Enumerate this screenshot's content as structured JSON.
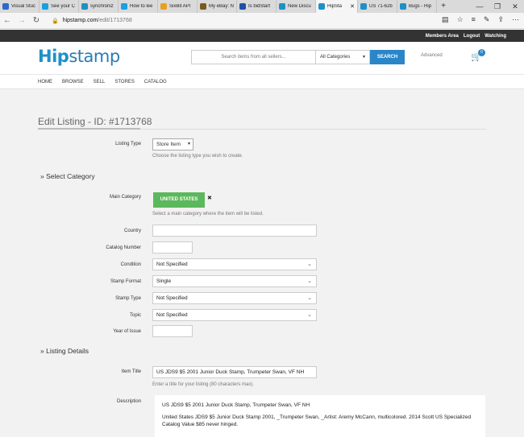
{
  "browser": {
    "tabs": [
      {
        "label": "Visual Stuc",
        "color": "#2a6ac8"
      },
      {
        "label": "See your C",
        "color": "#18a0e0"
      },
      {
        "label": "synchroniz",
        "color": "#1d8fc4"
      },
      {
        "label": "How to lee",
        "color": "#18a0e0"
      },
      {
        "label": "SixBit API",
        "color": "#e8a020"
      },
      {
        "label": "My eBay: N",
        "color": "#7a5a20"
      },
      {
        "label": "Is bidStart",
        "color": "#2050a8"
      },
      {
        "label": "New Discu",
        "color": "#1e90c8"
      },
      {
        "label": "HipSta",
        "color": "#1e90c8",
        "active": true
      },
      {
        "label": "US 71-62b",
        "color": "#1e90c8"
      },
      {
        "label": "Bugs - Hip",
        "color": "#1e90c8"
      }
    ],
    "close_tab_glyph": "✕",
    "new_tab_glyph": "+",
    "window_controls": [
      "—",
      "❐",
      "✕"
    ],
    "url_domain": "hipstamp.com",
    "url_path": "/edit/1713768",
    "toolbar_icons": [
      "reading-view-icon",
      "favorites-star-icon",
      "hub-icon",
      "notes-icon",
      "share-icon",
      "more-icon"
    ]
  },
  "site": {
    "top_links": [
      "Members Area",
      "Logout",
      "Watching"
    ],
    "logo": {
      "hip": "Hip",
      "stamp": "stamp"
    },
    "search": {
      "placeholder": "Search items from all sellers...",
      "category": "All Categories",
      "button": "SEARCH",
      "advanced": "Advanced"
    },
    "cart_count": "0",
    "nav": [
      "HOME",
      "BROWSE",
      "SELL",
      "STORES",
      "CATALOG"
    ]
  },
  "page": {
    "title": "Edit Listing - ID: #1713768",
    "listing_type": {
      "label": "Listing Type",
      "value": "Store Item",
      "hint": "Choose the listing type you wish to create."
    },
    "select_category": {
      "heading": "» Select Category",
      "main_category_label": "Main Category",
      "main_category_value": "UNITED STATES",
      "remove_glyph": "✖",
      "hint": "Select a main category where the item will be listed."
    },
    "fields": {
      "country": {
        "label": "Country",
        "value": ""
      },
      "catalog_number": {
        "label": "Catalog Number",
        "value": ""
      },
      "condition": {
        "label": "Condition",
        "value": "Not Specified"
      },
      "stamp_format": {
        "label": "Stamp Format",
        "value": "Single"
      },
      "stamp_type": {
        "label": "Stamp Type",
        "value": "Not Specified"
      },
      "topic": {
        "label": "Topic",
        "value": "Not Specified"
      },
      "year_of_issue": {
        "label": "Year of Issue",
        "value": ""
      }
    },
    "listing_details": {
      "heading": "» Listing Details",
      "item_title_label": "Item Title",
      "item_title_value": "US JDS9 $5 2001 Junior Duck Stamp, Trumpeter Swan, VF NH",
      "item_title_hint": "Enter a title for your listing (80 characters max).",
      "description_label": "Description",
      "description_lines": [
        "US JDS9 $5 2001 Junior Duck Stamp, Trumpeter Swan, VF NH",
        "United States JDS9 $5 Junior Duck Stamp 2001, _Trumpeter Swan, _Artist: Aremy McCann, multicolored. 2014 Scott US Specialized Catalog Value $85 never hinged."
      ]
    }
  },
  "colors": {
    "brand": "#1e90c8",
    "search_button": "#2a86c8",
    "category_tag": "#5cb85c",
    "topbar": "#333333"
  }
}
